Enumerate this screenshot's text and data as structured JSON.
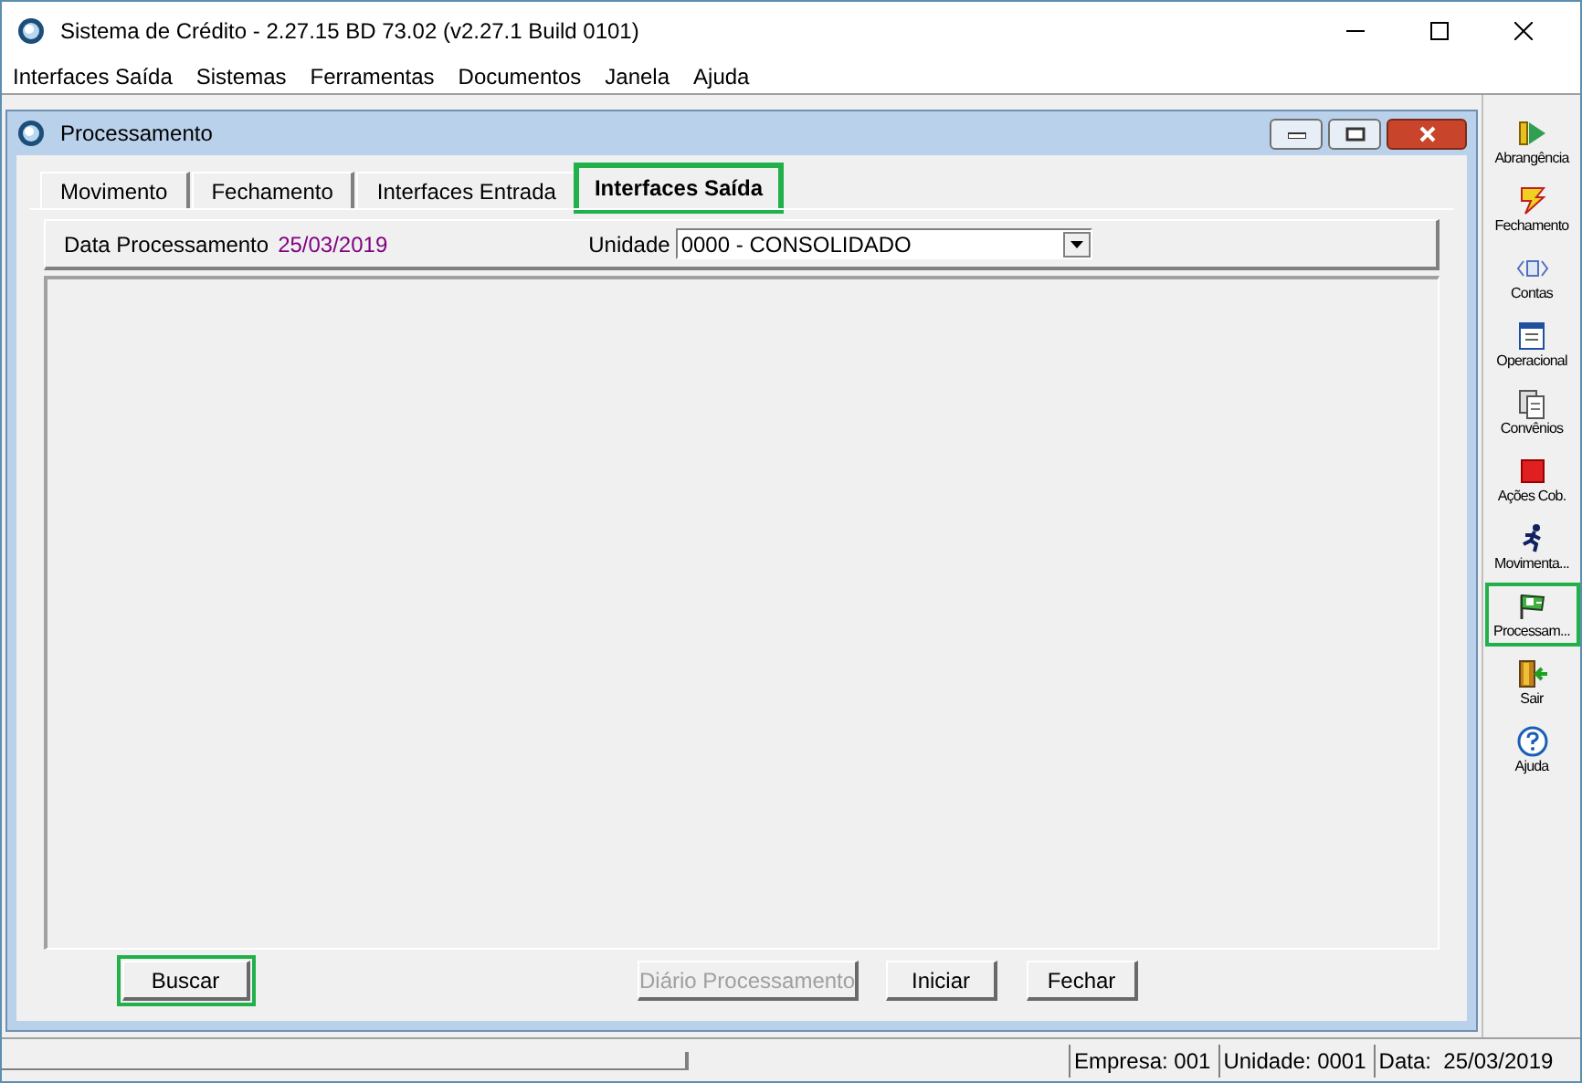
{
  "window": {
    "title": "Sistema de Crédito - 2.27.15 BD 73.02 (v2.27.1 Build 0101)"
  },
  "menu": [
    {
      "label": "Interfaces Saída"
    },
    {
      "label": "Sistemas"
    },
    {
      "label": "Ferramentas"
    },
    {
      "label": "Documentos"
    },
    {
      "label": "Janela"
    },
    {
      "label": "Ajuda"
    }
  ],
  "child_window": {
    "title": "Processamento",
    "tabs": [
      {
        "label": "Movimento",
        "selected": false,
        "highlighted": false
      },
      {
        "label": "Fechamento",
        "selected": false,
        "highlighted": false
      },
      {
        "label": "Interfaces Entrada",
        "selected": false,
        "highlighted": false
      },
      {
        "label": "Interfaces Saída",
        "selected": true,
        "highlighted": true
      }
    ],
    "date_label": "Data Processamento",
    "date_value": "25/03/2019",
    "unit_label": "Unidade",
    "unit_value": "0000 - CONSOLIDADO",
    "buttons": [
      {
        "label": "Buscar",
        "disabled": false,
        "highlighted": true
      },
      {
        "label": "Diário Processamento",
        "disabled": true,
        "highlighted": false
      },
      {
        "label": "Iniciar",
        "disabled": false,
        "highlighted": false
      },
      {
        "label": "Fechar",
        "disabled": false,
        "highlighted": false
      }
    ]
  },
  "toolbar": [
    {
      "label": "Abrangência",
      "kind": "flag",
      "highlighted": false
    },
    {
      "label": "Fechamento",
      "kind": "bolt",
      "highlighted": false
    },
    {
      "label": "Contas",
      "kind": "accounts",
      "highlighted": false
    },
    {
      "label": "Operacional",
      "kind": "form",
      "highlighted": false
    },
    {
      "label": "Convênios",
      "kind": "docs",
      "highlighted": false
    },
    {
      "label": "Ações Cob.",
      "kind": "stop",
      "highlighted": false
    },
    {
      "label": "Movimenta...",
      "kind": "runner",
      "highlighted": false
    },
    {
      "label": "Processam...",
      "kind": "checkered",
      "highlighted": true
    },
    {
      "label": "Sair",
      "kind": "door",
      "highlighted": false
    },
    {
      "label": "Ajuda",
      "kind": "help",
      "highlighted": false
    }
  ],
  "status_bar": [
    "Empresa: 001",
    "Unidade: 0001",
    "Data:  25/03/2019"
  ]
}
